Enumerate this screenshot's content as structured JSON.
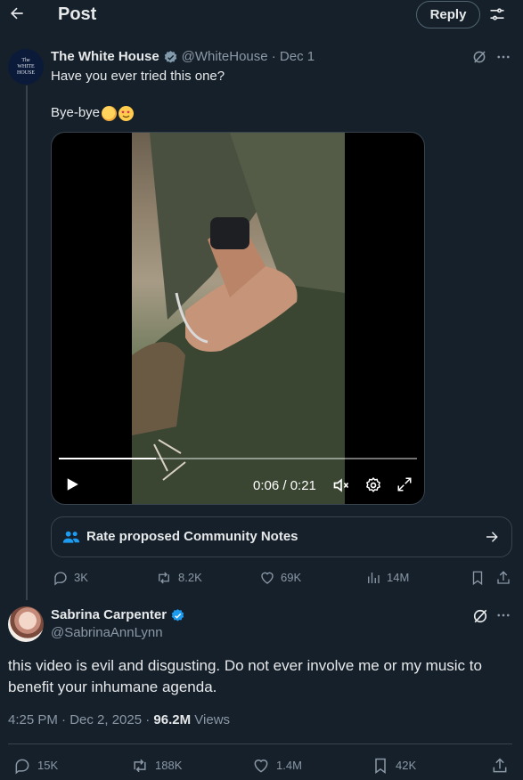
{
  "header": {
    "title": "Post",
    "reply_button": "Reply"
  },
  "quoted_post": {
    "avatar_text": [
      "The",
      "WHITE",
      "HOUSE"
    ],
    "name": "The White House",
    "handle": "@WhiteHouse",
    "date": "Dec 1",
    "handle_line": "@WhiteHouse · Dec 1",
    "text_line1": "Have you ever tried this one?",
    "text_line2": "Bye-bye",
    "emojis": [
      "waving-hand",
      "heart-eyes"
    ],
    "video": {
      "time": "0:06 / 0:21",
      "progress": 0.27
    },
    "community_notes": "Rate proposed Community Notes",
    "stats": {
      "replies": "3K",
      "reposts": "8.2K",
      "likes": "69K",
      "views": "14M"
    }
  },
  "reply_post": {
    "name": "Sabrina Carpenter",
    "handle": "@SabrinaAnnLynn",
    "text": "this video is evil and disgusting. Do not ever involve me or my music to benefit your inhumane agenda.",
    "timestamp": "4:25 PM · Dec 2, 2025 · ",
    "views_count": "96.2M",
    "views_label": " Views",
    "stats": {
      "replies": "15K",
      "reposts": "188K",
      "likes": "1.4M",
      "bookmarks": "42K"
    }
  },
  "colors": {
    "background": "#15202b",
    "verified": "#1d9bf0",
    "muted": "#8b98a5",
    "border": "#38444d"
  }
}
